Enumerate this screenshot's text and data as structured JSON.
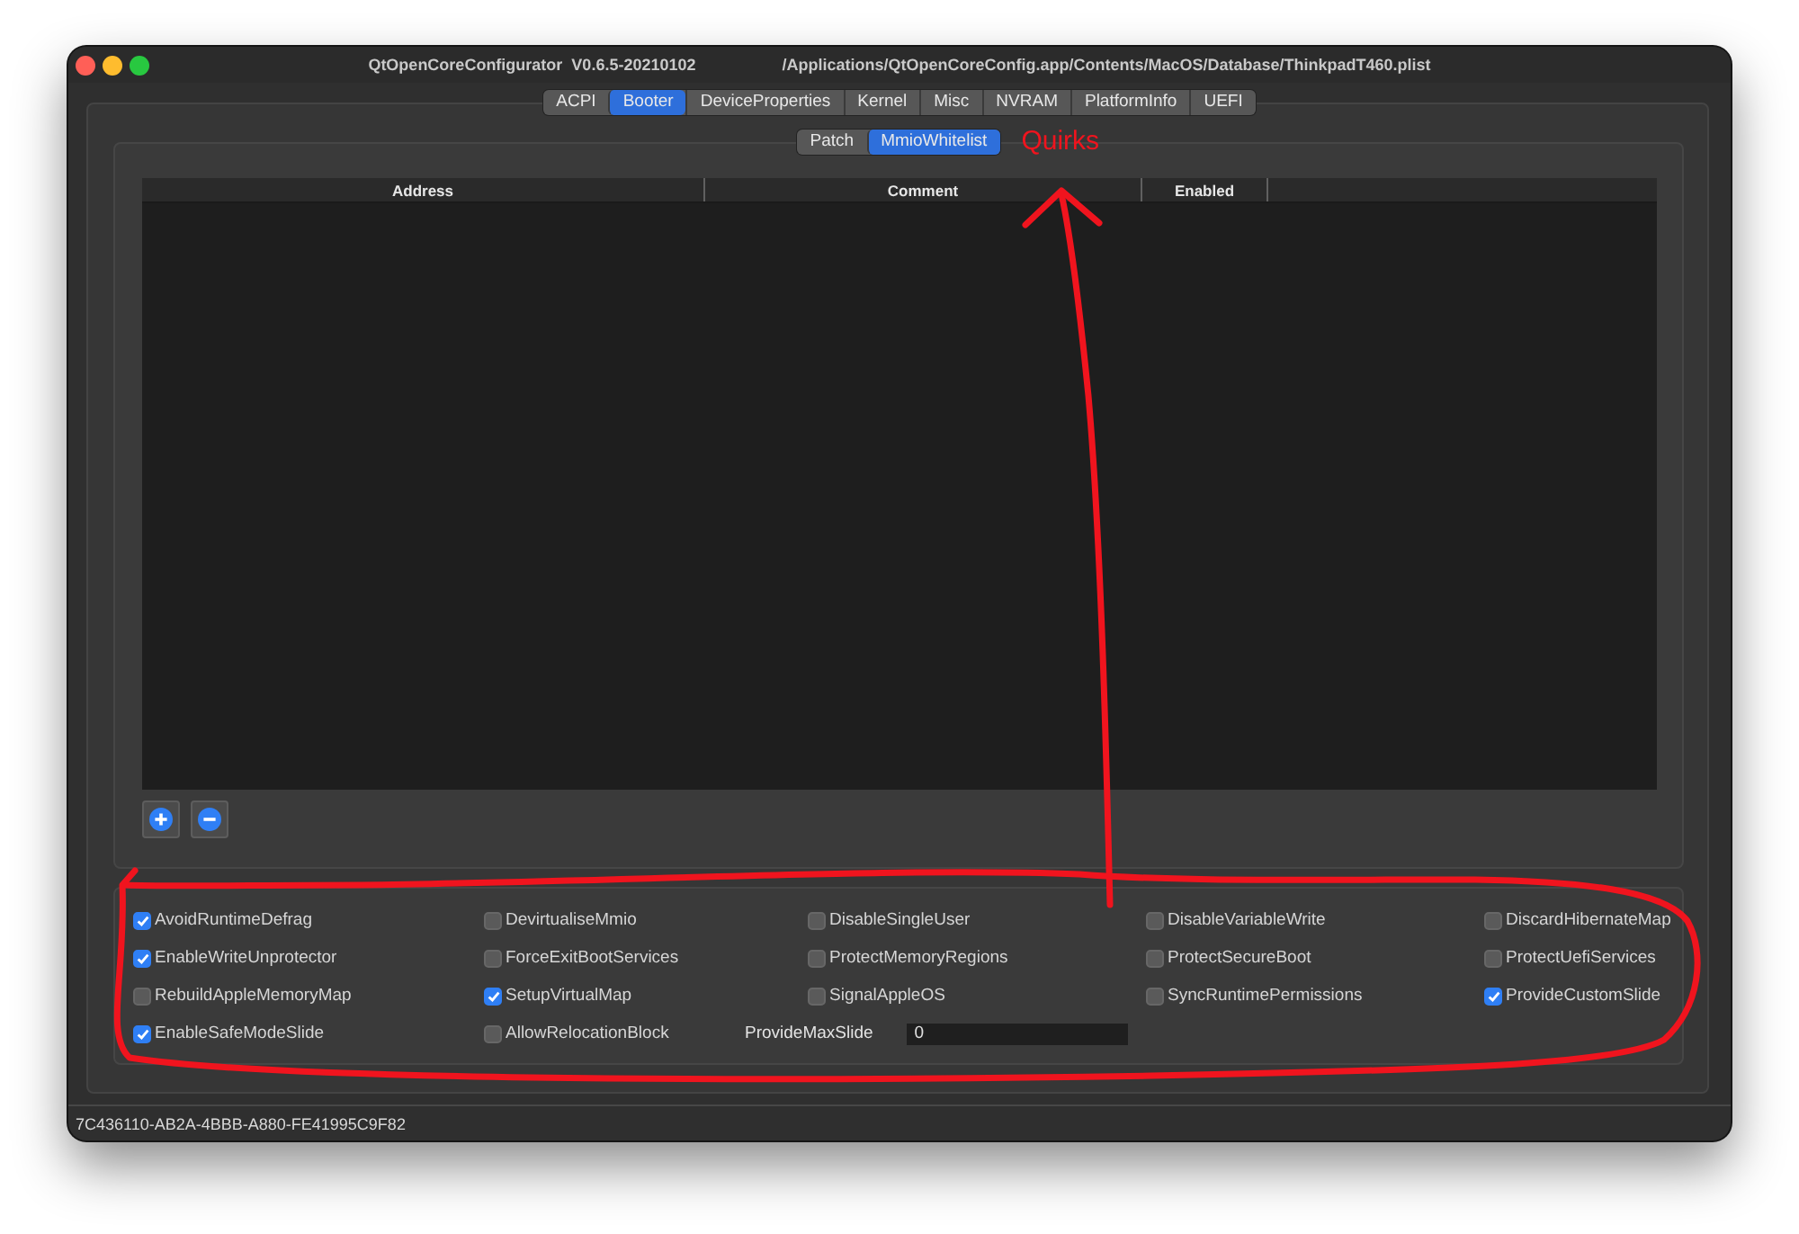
{
  "window": {
    "title": "QtOpenCoreConfigurator  V0.6.5-20210102",
    "file_path": "/Applications/QtOpenCoreConfig.app/Contents/MacOS/Database/ThinkpadT460.plist"
  },
  "tabs": [
    {
      "label": "ACPI",
      "selected": false
    },
    {
      "label": "Booter",
      "selected": true
    },
    {
      "label": "DeviceProperties",
      "selected": false
    },
    {
      "label": "Kernel",
      "selected": false
    },
    {
      "label": "Misc",
      "selected": false
    },
    {
      "label": "NVRAM",
      "selected": false
    },
    {
      "label": "PlatformInfo",
      "selected": false
    },
    {
      "label": "UEFI",
      "selected": false
    }
  ],
  "subtabs": [
    {
      "label": "Patch",
      "selected": false
    },
    {
      "label": "MmioWhitelist",
      "selected": true
    }
  ],
  "annotation": {
    "text": "Quirks"
  },
  "table": {
    "columns": [
      "Address",
      "Comment",
      "Enabled"
    ]
  },
  "list_buttons": [
    {
      "kind": "add"
    },
    {
      "kind": "remove"
    }
  ],
  "quirks": [
    {
      "kind": "checkbox",
      "label": "AvoidRuntimeDefrag",
      "checked": true
    },
    {
      "kind": "checkbox",
      "label": "DevirtualiseMmio",
      "checked": false
    },
    {
      "kind": "checkbox",
      "label": "DisableSingleUser",
      "checked": false
    },
    {
      "kind": "checkbox",
      "label": "DisableVariableWrite",
      "checked": false
    },
    {
      "kind": "checkbox",
      "label": "DiscardHibernateMap",
      "checked": false
    },
    {
      "kind": "checkbox",
      "label": "EnableWriteUnprotector",
      "checked": true
    },
    {
      "kind": "checkbox",
      "label": "ForceExitBootServices",
      "checked": false
    },
    {
      "kind": "checkbox",
      "label": "ProtectMemoryRegions",
      "checked": false
    },
    {
      "kind": "checkbox",
      "label": "ProtectSecureBoot",
      "checked": false
    },
    {
      "kind": "checkbox",
      "label": "ProtectUefiServices",
      "checked": false
    },
    {
      "kind": "checkbox",
      "label": "RebuildAppleMemoryMap",
      "checked": false
    },
    {
      "kind": "checkbox",
      "label": "SetupVirtualMap",
      "checked": true
    },
    {
      "kind": "checkbox",
      "label": "SignalAppleOS",
      "checked": false
    },
    {
      "kind": "checkbox",
      "label": "SyncRuntimePermissions",
      "checked": false
    },
    {
      "kind": "checkbox",
      "label": "ProvideCustomSlide",
      "checked": true
    },
    {
      "kind": "checkbox",
      "label": "EnableSafeModeSlide",
      "checked": true
    },
    {
      "kind": "checkbox",
      "label": "AllowRelocationBlock",
      "checked": false
    },
    {
      "kind": "number",
      "label": "ProvideMaxSlide",
      "value": "0"
    }
  ],
  "status_bar": {
    "text": "7C436110-AB2A-4BBB-A880-FE41995C9F82"
  }
}
